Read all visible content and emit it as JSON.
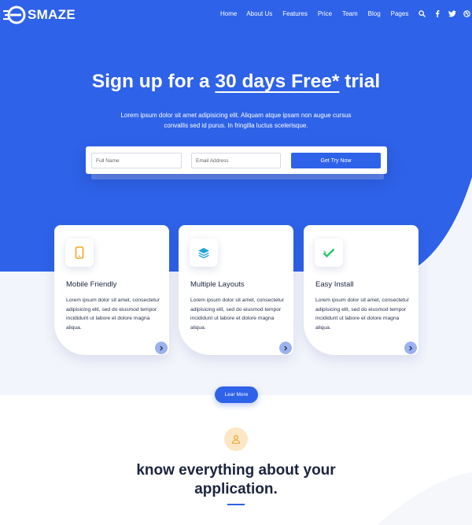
{
  "brand": {
    "name": "SMAZE",
    "accent": "#2e62e8"
  },
  "nav": {
    "items": [
      "Home",
      "About Us",
      "Features",
      "Price",
      "Team",
      "Blog",
      "Pages"
    ],
    "icons": [
      "search-icon",
      "facebook-icon",
      "twitter-icon",
      "dribbble-icon"
    ]
  },
  "hero": {
    "title_prefix": "Sign up for a ",
    "title_highlight": "30 days Free*",
    "title_suffix": " trial",
    "description": "Lorem ipsum dolor sit amet adipisicing elit. Aliquam atque ipsam non augue cursus convallis sed id purus. In fringilla luctus scelerisque."
  },
  "signup_form": {
    "name_placeholder": "Full Name",
    "email_placeholder": "Email Address",
    "name_value": "",
    "email_value": "",
    "submit_label": "Get Try Now"
  },
  "features": [
    {
      "icon": "mobile-icon",
      "title": "Mobile Friendly",
      "text": "Lorem ipsum dolor sit amet, consectetur adipisicing elit, sed do eiusmod tempor incididunt ut labore et dolore magna aliqua."
    },
    {
      "icon": "layers-icon",
      "title": "Multiple Layouts",
      "text": "Lorem ipsum dolor sit amet, consectetur adipisicing elit, sed do eiusmod tempor incididunt ut labore et dolore magna aliqua."
    },
    {
      "icon": "check-icon",
      "title": "Easy Install",
      "text": "Lorem ipsum dolor sit amet, consectetur adipisicing elit, sed do eiusmod tempor incididunt ut labore et dolore magna aliqua."
    }
  ],
  "learn_more_label": "Lear More",
  "about": {
    "icon": "user-icon",
    "title": "know everything about your application."
  }
}
